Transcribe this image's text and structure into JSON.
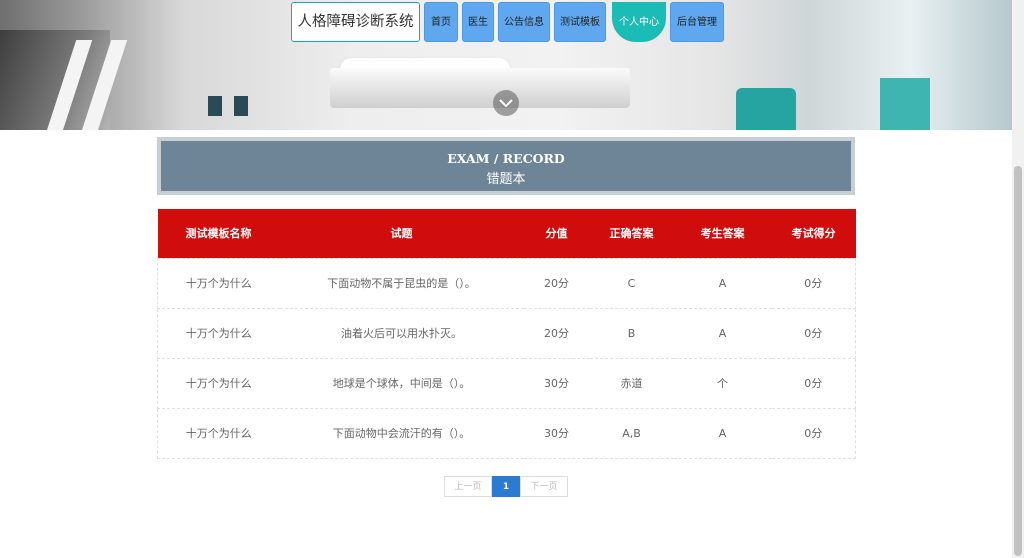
{
  "nav": {
    "logo": "人格障碍诊断系统",
    "items": [
      {
        "label": "首页",
        "active": false
      },
      {
        "label": "医生",
        "active": false
      },
      {
        "label": "公告信息",
        "active": false
      },
      {
        "label": "测试模板",
        "active": false
      },
      {
        "label": "个人中心",
        "active": true
      },
      {
        "label": "后台管理",
        "active": false
      }
    ]
  },
  "section": {
    "title_en": "EXAM / RECORD",
    "title_cn": "错题本"
  },
  "table": {
    "headers": [
      "测试模板名称",
      "试题",
      "分值",
      "正确答案",
      "考生答案",
      "考试得分"
    ],
    "rows": [
      [
        "十万个为什么",
        "下面动物不属于昆虫的是（）。",
        "20分",
        "C",
        "A",
        "0分"
      ],
      [
        "十万个为什么",
        "油着火后可以用水扑灭。",
        "20分",
        "B",
        "A",
        "0分"
      ],
      [
        "十万个为什么",
        "地球是个球体，中间是（）。",
        "30分",
        "赤道",
        "个",
        "0分"
      ],
      [
        "十万个为什么",
        "下面动物中会流汗的有（）。",
        "30分",
        "A,B",
        "A",
        "0分"
      ]
    ]
  },
  "pagination": {
    "prev": "上一页",
    "current": "1",
    "next": "下一页"
  },
  "colors": {
    "header_red": "#d10c0c",
    "nav_blue": "#5fa8f0",
    "nav_active_teal": "#1cbcb6",
    "title_slate": "#6d8597"
  },
  "icons": {
    "banner_toggle": "chevron-down-icon"
  }
}
